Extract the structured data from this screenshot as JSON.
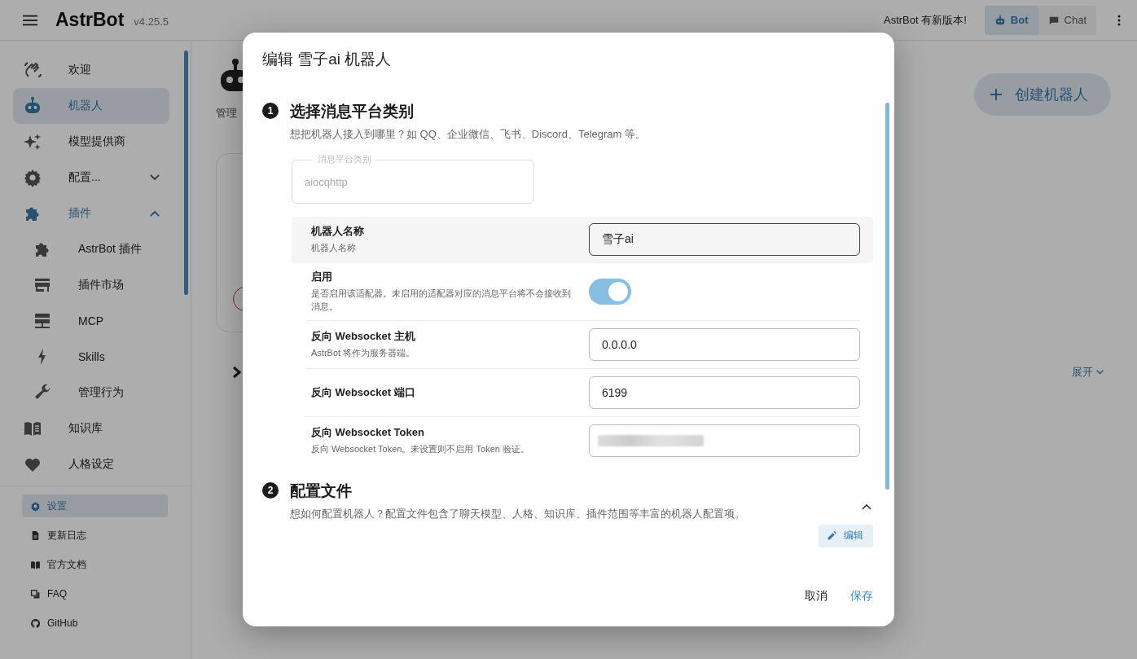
{
  "header": {
    "brand": "AstrBot",
    "version": "v4.25.5",
    "update_notice": "AstrBot 有新版本!",
    "modes": [
      {
        "label": "Bot",
        "selected": true
      },
      {
        "label": "Chat",
        "selected": false
      }
    ]
  },
  "sidebar": {
    "items": [
      {
        "label": "欢迎",
        "selected": false
      },
      {
        "label": "机器人",
        "selected": true
      },
      {
        "label": "模型提供商",
        "selected": false
      },
      {
        "label": "配置...",
        "selected": false,
        "expanded": false
      },
      {
        "label": "插件",
        "selected": false,
        "expanded": true,
        "children": [
          {
            "label": "AstrBot 插件",
            "selected": false
          },
          {
            "label": "插件市场",
            "selected": false
          },
          {
            "label": "MCP",
            "selected": false
          },
          {
            "label": "Skills",
            "selected": false
          },
          {
            "label": "管理行为",
            "selected": false
          }
        ]
      },
      {
        "label": "知识库",
        "selected": false
      },
      {
        "label": "人格设定",
        "selected": false
      }
    ],
    "footer_links": [
      {
        "label": "设置",
        "selected": true
      },
      {
        "label": "更新日志",
        "selected": false
      },
      {
        "label": "官方文档",
        "selected": false
      },
      {
        "label": "FAQ",
        "selected": false
      },
      {
        "label": "GitHub",
        "selected": false
      }
    ]
  },
  "main": {
    "subtitle": "管理",
    "create_button": "创建机器人",
    "expand_link": "展开"
  },
  "dialog": {
    "title": "编辑 雪子ai 机器人",
    "sections": [
      {
        "number": "1",
        "title": "选择消息平台类别",
        "description": "想把机器人接入到哪里？如 QQ、企业微信、飞书、Discord、Telegram 等。"
      },
      {
        "number": "2",
        "title": "配置文件",
        "description": "想如何配置机器人？配置文件包含了聊天模型、人格、知识库、插件范围等丰富的机器人配置项。",
        "expanded": true,
        "edit_button": "编辑"
      }
    ],
    "platform_field": {
      "label": "消息平台类别",
      "value": "aiocqhttp",
      "disabled": true
    },
    "settings": [
      {
        "kind": "text",
        "label": "机器人名称",
        "description": "机器人名称",
        "value": "雪子ai",
        "highlighted": true
      },
      {
        "kind": "switch",
        "label": "启用",
        "description": "是否启用该适配器。未启用的适配器对应的消息平台将不会接收到消息。",
        "on": true,
        "highlighted": false
      },
      {
        "kind": "text",
        "label": "反向 Websocket 主机",
        "description": "AstrBot 将作为服务器端。",
        "value": "0.0.0.0",
        "highlighted": false
      },
      {
        "kind": "text",
        "label": "反向 Websocket 端口",
        "value": "6199",
        "highlighted": false
      },
      {
        "kind": "secret",
        "label": "反向 Websocket Token",
        "description": "反向 Websocket Token。未设置则不启用 Token 验证。",
        "highlighted": false
      }
    ],
    "buttons": [
      {
        "label": "取消",
        "kind": "text"
      },
      {
        "label": "保存",
        "kind": "primary"
      }
    ]
  }
}
